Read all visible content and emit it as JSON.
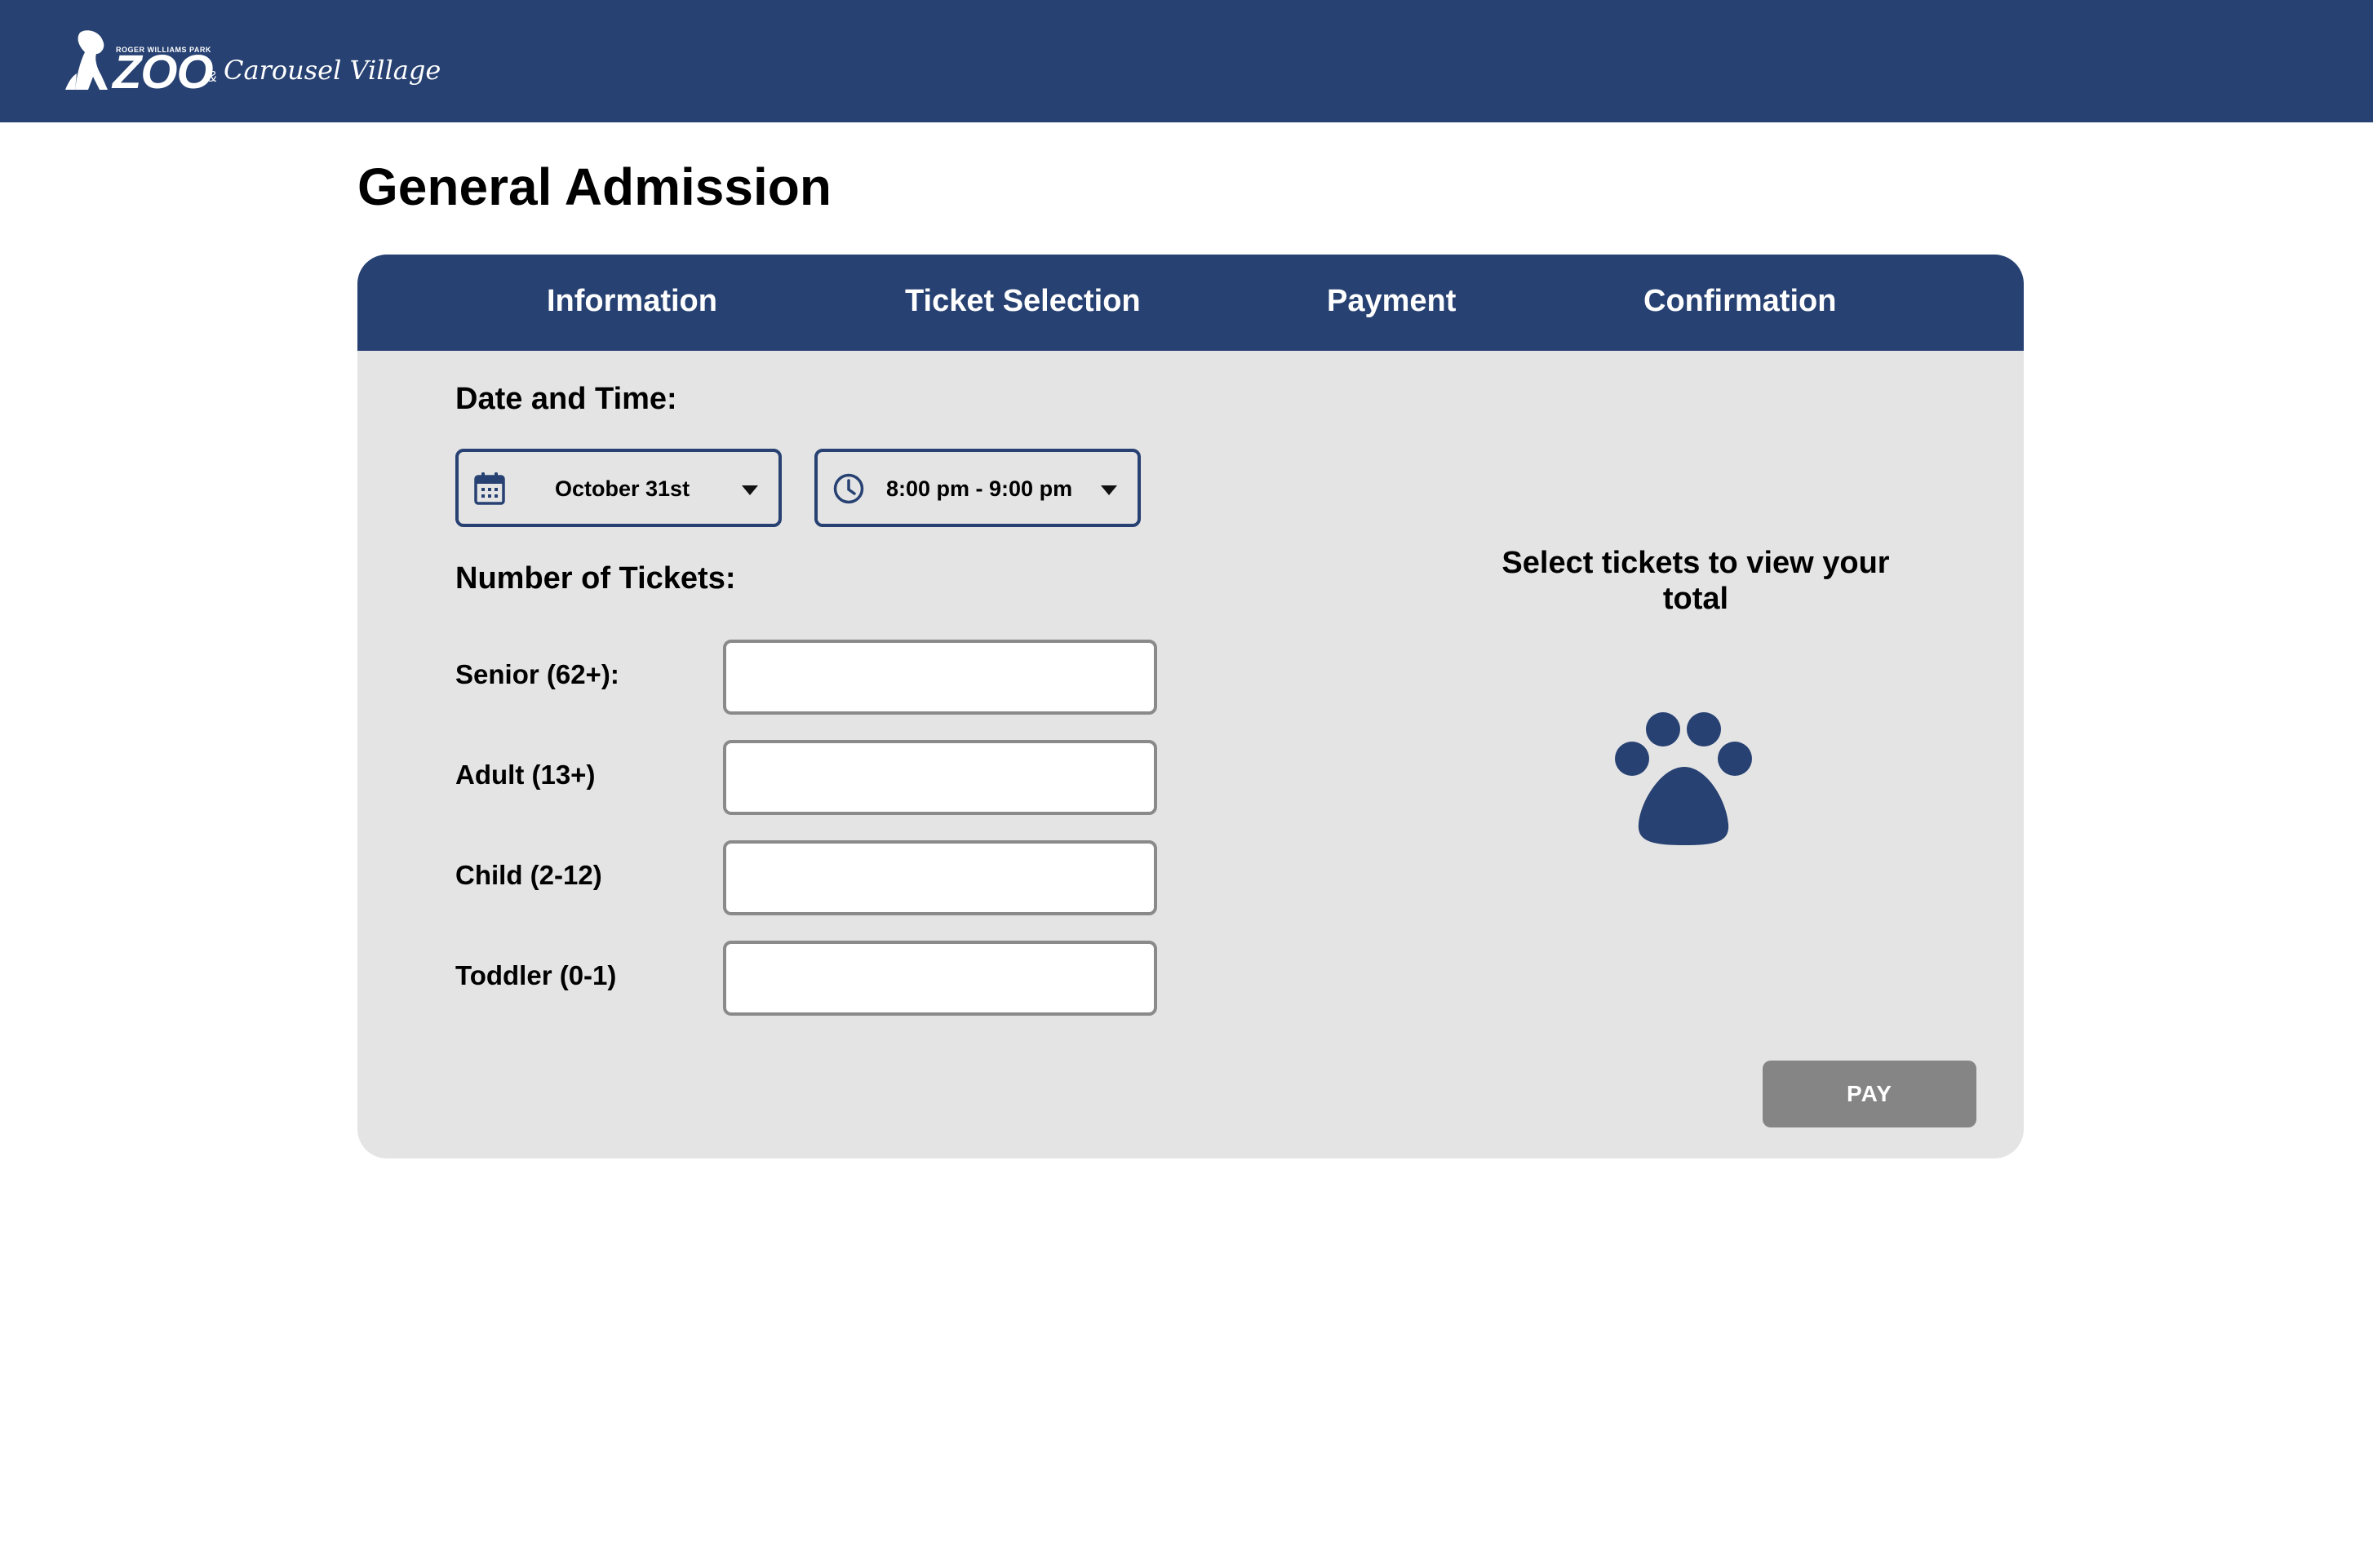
{
  "header": {
    "logo": {
      "small_text": "ROGER WILLIAMS PARK",
      "main_text": "ZOO",
      "amp": "&",
      "secondary_text": "Carousel Village"
    }
  },
  "page": {
    "title": "General Admission"
  },
  "steps": [
    {
      "label": "Information"
    },
    {
      "label": "Ticket Selection"
    },
    {
      "label": "Payment"
    },
    {
      "label": "Confirmation"
    }
  ],
  "date_time": {
    "label": "Date and Time:",
    "date": {
      "icon": "calendar-icon",
      "value": "October 31st"
    },
    "time": {
      "icon": "clock-icon",
      "value": "8:00 pm - 9:00 pm"
    }
  },
  "tickets": {
    "label": "Number of Tickets:",
    "rows": [
      {
        "label": "Senior (62+):",
        "value": ""
      },
      {
        "label": "Adult (13+)",
        "value": ""
      },
      {
        "label": "Child (2-12)",
        "value": ""
      },
      {
        "label": "Toddler (0-1)",
        "value": ""
      }
    ]
  },
  "summary": {
    "message": "Select tickets to view your total",
    "icon": "paw-icon"
  },
  "pay_button": {
    "label": "PAY"
  },
  "colors": {
    "brand": "#274172",
    "card_bg": "#e4e4e4",
    "button_disabled": "#858585"
  }
}
